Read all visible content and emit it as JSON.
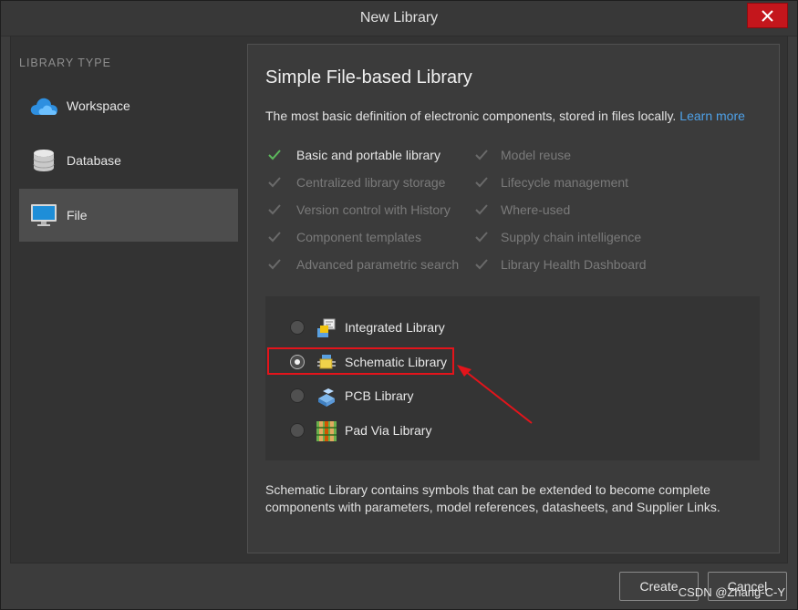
{
  "window": {
    "title": "New Library",
    "close_label": "✕"
  },
  "sidebar": {
    "header": "LIBRARY TYPE",
    "items": [
      {
        "label": "Workspace",
        "icon": "cloud-icon",
        "active": false
      },
      {
        "label": "Database",
        "icon": "database-icon",
        "active": false
      },
      {
        "label": "File",
        "icon": "monitor-icon",
        "active": true
      }
    ]
  },
  "main": {
    "title": "Simple File-based Library",
    "description": "The most basic definition of electronic components, stored in files locally.",
    "learn_more": "Learn more",
    "features_left": [
      {
        "label": "Basic and portable library",
        "enabled": true
      },
      {
        "label": "Centralized library storage",
        "enabled": false
      },
      {
        "label": "Version control with History",
        "enabled": false
      },
      {
        "label": "Component templates",
        "enabled": false
      },
      {
        "label": "Advanced parametric search",
        "enabled": false
      }
    ],
    "features_right": [
      {
        "label": "Model reuse",
        "enabled": false
      },
      {
        "label": "Lifecycle management",
        "enabled": false
      },
      {
        "label": "Where-used",
        "enabled": false
      },
      {
        "label": "Supply chain intelligence",
        "enabled": false
      },
      {
        "label": "Library Health Dashboard",
        "enabled": false
      }
    ],
    "library_options": [
      {
        "label": "Integrated Library",
        "icon": "integrated-library-icon",
        "selected": false
      },
      {
        "label": "Schematic Library",
        "icon": "schematic-library-icon",
        "selected": true
      },
      {
        "label": "PCB Library",
        "icon": "pcb-library-icon",
        "selected": false
      },
      {
        "label": "Pad Via Library",
        "icon": "pad-via-library-icon",
        "selected": false
      }
    ],
    "footer_text_line1": "Schematic Library contains symbols that can be extended to become complete",
    "footer_text_line2": "components with parameters, model references, datasheets, and Supplier Links."
  },
  "buttons": {
    "create": "Create",
    "cancel": "Cancel"
  },
  "watermark": "CSDN @Zhang-C-Y",
  "colors": {
    "accent_link": "#4ea1e8",
    "check_on": "#5cb85c",
    "highlight": "#e3141b",
    "close": "#c4161c"
  }
}
